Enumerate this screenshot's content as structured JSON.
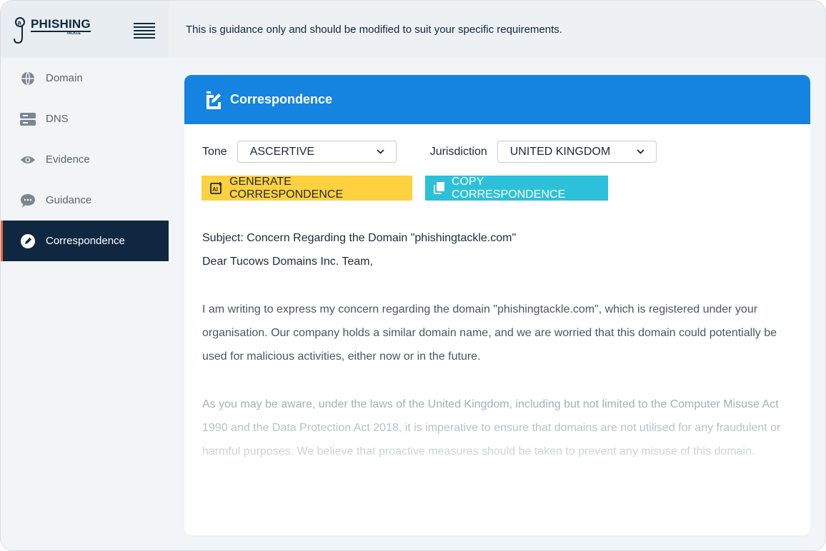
{
  "brand": {
    "name": "PHISHING",
    "sub": "TACKLE"
  },
  "sidebar": {
    "items": [
      {
        "label": "Domain",
        "icon": "globe-icon"
      },
      {
        "label": "DNS",
        "icon": "server-icon"
      },
      {
        "label": "Evidence",
        "icon": "eye-icon"
      },
      {
        "label": "Guidance",
        "icon": "chat-icon"
      },
      {
        "label": "Correspondence",
        "icon": "pencil-icon",
        "active": true
      }
    ]
  },
  "topbar": {
    "notice": "This is guidance only and should be modified to suit your specific requirements."
  },
  "card": {
    "title": "Correspondence",
    "tone_label": "Tone",
    "tone_value": "ASCERTIVE",
    "jurisdiction_label": "Jurisdiction",
    "jurisdiction_value": "UNITED KINGDOM",
    "generate_label": "GENERATE CORRESPONDENCE",
    "copy_label": "COPY CORRESPONDENCE"
  },
  "letter": {
    "subject": "Subject: Concern Regarding the Domain \"phishingtackle.com\"",
    "greeting": "Dear Tucows Domains Inc. Team,",
    "paragraph1": "I am writing to express my concern regarding the domain \"phishingtackle.com\", which is registered under your organisation. Our company holds a similar domain name, and we are worried that this domain could potentially be used for malicious activities, either now or in the future.",
    "paragraph2": "As you may be aware, under the laws of the United Kingdom, including but not limited to the Computer Misuse Act 1990 and the Data Protection Act 2018, it is imperative to ensure that domains are not utilised for any fraudulent or harmful purposes. We believe that proactive measures should be taken to prevent any misuse of this domain."
  },
  "colors": {
    "navy": "#0f2740",
    "accent_orange": "#e5683a",
    "header_blue": "#1584e0",
    "generate_yellow": "#fdd13f",
    "copy_cyan": "#2cc0d9"
  }
}
